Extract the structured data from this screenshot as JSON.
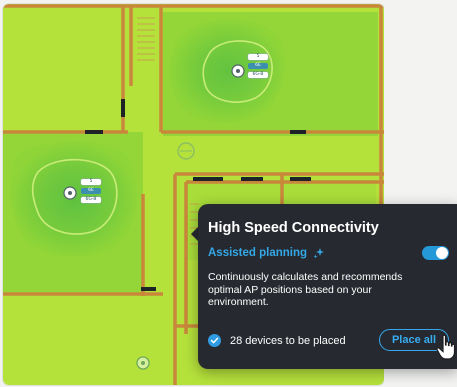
{
  "floor_plan": {
    "access_points": [
      {
        "name": "top-ap",
        "labels": [
          "5",
          "6E",
          "6G-B"
        ]
      },
      {
        "name": "left-ap",
        "labels": [
          "5",
          "6E",
          "6G-B"
        ]
      }
    ],
    "heatmap_colors": {
      "background": "#b8e33a",
      "mid": "#93d638",
      "strong": "#6dc83d",
      "ring": "#cfee7c",
      "wall": "#c9863a",
      "door": "#1d2326"
    }
  },
  "popover": {
    "title": "High Speed Connectivity",
    "assisted_label": "Assisted planning",
    "assisted_icon": "sparkle-icon",
    "toggle_on": true,
    "description": "Continuously calculates and recommends optimal AP positions based on your environment.",
    "devices_text": "28 devices to be placed",
    "devices_icon": "check-circle-icon",
    "place_all_label": "Place all",
    "accent": "#2f9be2"
  }
}
